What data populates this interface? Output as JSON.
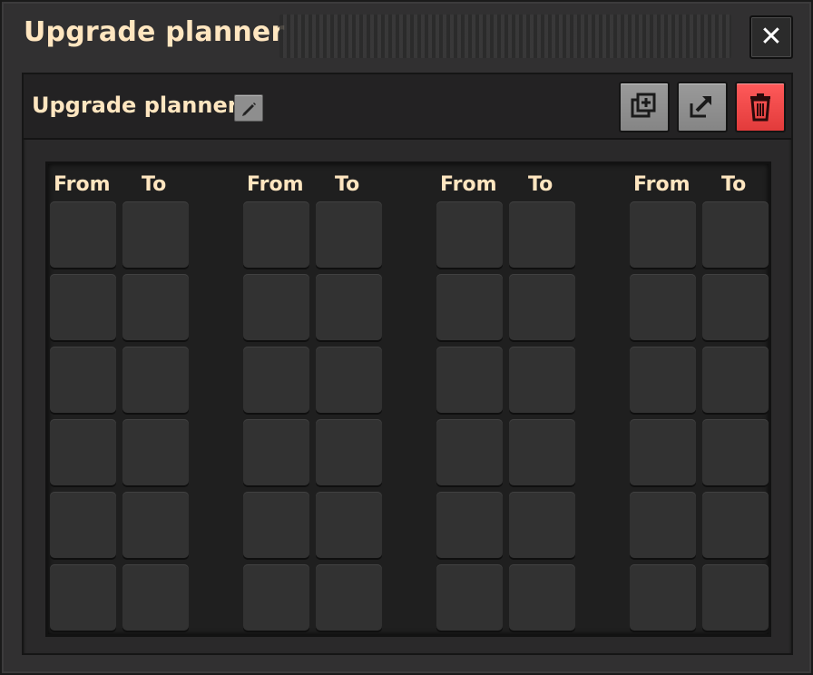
{
  "window": {
    "title": "Upgrade planner",
    "close_label": "✕"
  },
  "planner": {
    "name": "Upgrade planner",
    "icons": {
      "rename": "pencil-icon",
      "copy": "copy-icon",
      "export": "export-icon",
      "delete": "trash-icon"
    },
    "colors": {
      "title_text": "#ffe6c0",
      "delete_button": "#e23b3b"
    }
  },
  "mapping_grid": {
    "columns": [
      {
        "from_label": "From",
        "to_label": "To"
      },
      {
        "from_label": "From",
        "to_label": "To"
      },
      {
        "from_label": "From",
        "to_label": "To"
      },
      {
        "from_label": "From",
        "to_label": "To"
      }
    ],
    "rows": 6
  }
}
